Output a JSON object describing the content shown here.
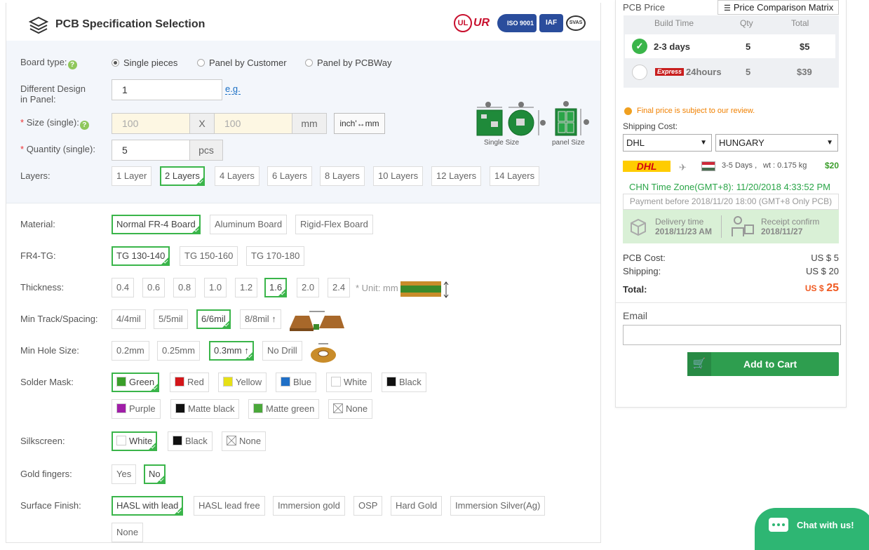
{
  "header": {
    "title": "PCB Specification Selection",
    "cert_logos": [
      "UL",
      "UR",
      "ISO 9001",
      "IAF",
      "SVAS"
    ]
  },
  "board_type": {
    "label": "Board type:",
    "options": [
      "Single pieces",
      "Panel by Customer",
      "Panel by PCBWay"
    ],
    "selected": "Single pieces"
  },
  "different_design": {
    "label_l1": "Different Design",
    "label_l2": "in Panel:",
    "value": "1",
    "eg": "e.g."
  },
  "size": {
    "label": "Size (single):",
    "star": "*",
    "width_placeholder": "100",
    "x": "X",
    "height_placeholder": "100",
    "unit": "mm",
    "convert": "inch'↔mm",
    "single_caption": "Single Size",
    "panel_caption": "panel Size"
  },
  "quantity": {
    "label": "Quantity (single):",
    "star": "*",
    "value": "5",
    "unit": "pcs"
  },
  "layers": {
    "label": "Layers:",
    "options": [
      "1 Layer",
      "2 Layers",
      "4 Layers",
      "6 Layers",
      "8 Layers",
      "10 Layers",
      "12 Layers",
      "14 Layers"
    ],
    "selected": "2 Layers"
  },
  "material": {
    "label": "Material:",
    "options": [
      "Normal FR-4 Board",
      "Aluminum Board",
      "Rigid-Flex Board"
    ],
    "selected": "Normal FR-4 Board"
  },
  "fr4tg": {
    "label": "FR4-TG:",
    "options": [
      "TG 130-140",
      "TG 150-160",
      "TG 170-180"
    ],
    "selected": "TG 130-140"
  },
  "thickness": {
    "label": "Thickness:",
    "options": [
      "0.4",
      "0.6",
      "0.8",
      "1.0",
      "1.2",
      "1.6",
      "2.0",
      "2.4"
    ],
    "selected": "1.6",
    "unit_note": "* Unit: mm"
  },
  "track": {
    "label": "Min Track/Spacing:",
    "options": [
      "4/4mil",
      "5/5mil",
      "6/6mil",
      "8/8mil ↑"
    ],
    "selected": "6/6mil"
  },
  "hole": {
    "label": "Min Hole Size:",
    "options": [
      "0.2mm",
      "0.25mm",
      "0.3mm ↑",
      "No Drill"
    ],
    "selected": "0.3mm ↑"
  },
  "solder_mask": {
    "label": "Solder Mask:",
    "row1": [
      {
        "name": "Green",
        "color": "#3a9e2a"
      },
      {
        "name": "Red",
        "color": "#d4161a"
      },
      {
        "name": "Yellow",
        "color": "#e6e016"
      },
      {
        "name": "Blue",
        "color": "#1f6fc6"
      },
      {
        "name": "White",
        "color": "#ffffff"
      },
      {
        "name": "Black",
        "color": "#111111"
      }
    ],
    "row2": [
      {
        "name": "Purple",
        "color": "#a01ea8"
      },
      {
        "name": "Matte black",
        "color": "#111111"
      },
      {
        "name": "Matte green",
        "color": "#4aa83a"
      },
      {
        "name": "None",
        "color": "none"
      }
    ],
    "selected": "Green"
  },
  "silkscreen": {
    "label": "Silkscreen:",
    "options": [
      {
        "name": "White",
        "color": "#ffffff"
      },
      {
        "name": "Black",
        "color": "#111111"
      },
      {
        "name": "None",
        "color": "none"
      }
    ],
    "selected": "White"
  },
  "gold_fingers": {
    "label": "Gold fingers:",
    "options": [
      "Yes",
      "No"
    ],
    "selected": "No"
  },
  "surface": {
    "label": "Surface Finish:",
    "options": [
      "HASL with lead",
      "HASL lead free",
      "Immersion gold",
      "OSP",
      "Hard Gold",
      "Immersion Silver(Ag)",
      "None"
    ],
    "selected": "HASL with lead"
  },
  "price": {
    "title": "PCB Price",
    "compare": "Price Comparison Matrix",
    "columns": [
      "Build Time",
      "Qty",
      "Total"
    ],
    "rows": [
      {
        "time": "2-3 days",
        "qty": "5",
        "total": "$5",
        "selected": true
      },
      {
        "badge": "Express",
        "time": "24hours",
        "qty": "5",
        "total": "$39",
        "selected": false
      }
    ]
  },
  "notice": "Final price is subject to our review.",
  "shipping": {
    "label": "Shipping Cost:",
    "method": "DHL",
    "country": "HUNGARY",
    "carrier": "DHL",
    "days": "3-5 Days ,",
    "weight": "wt : 0.175 kg",
    "cost": "$20"
  },
  "timezone": "CHN Time Zone(GMT+8): 11/20/2018 4:33:52 PM",
  "payment_before": "Payment before 2018/11/20 18:00 (GMT+8 Only PCB)",
  "delivery": {
    "label": "Delivery time",
    "date": "2018/11/23 AM"
  },
  "receipt": {
    "label": "Receipt confirm",
    "date": "2018/11/27"
  },
  "costs": {
    "pcb_label": "PCB Cost:",
    "pcb_value": "US $ 5",
    "ship_label": "Shipping:",
    "ship_value": "US $ 20",
    "total_label": "Total:",
    "total_prefix": "US $",
    "total_value": "25"
  },
  "email": {
    "label": "Email",
    "placeholder": ""
  },
  "cart": "Add to Cart",
  "chat": "Chat with us!",
  "colors": {
    "accent_green": "#3ab54a",
    "cart_green": "#2e9e4f",
    "total_orange": "#f05a22",
    "link_blue": "#1a6fc4"
  }
}
